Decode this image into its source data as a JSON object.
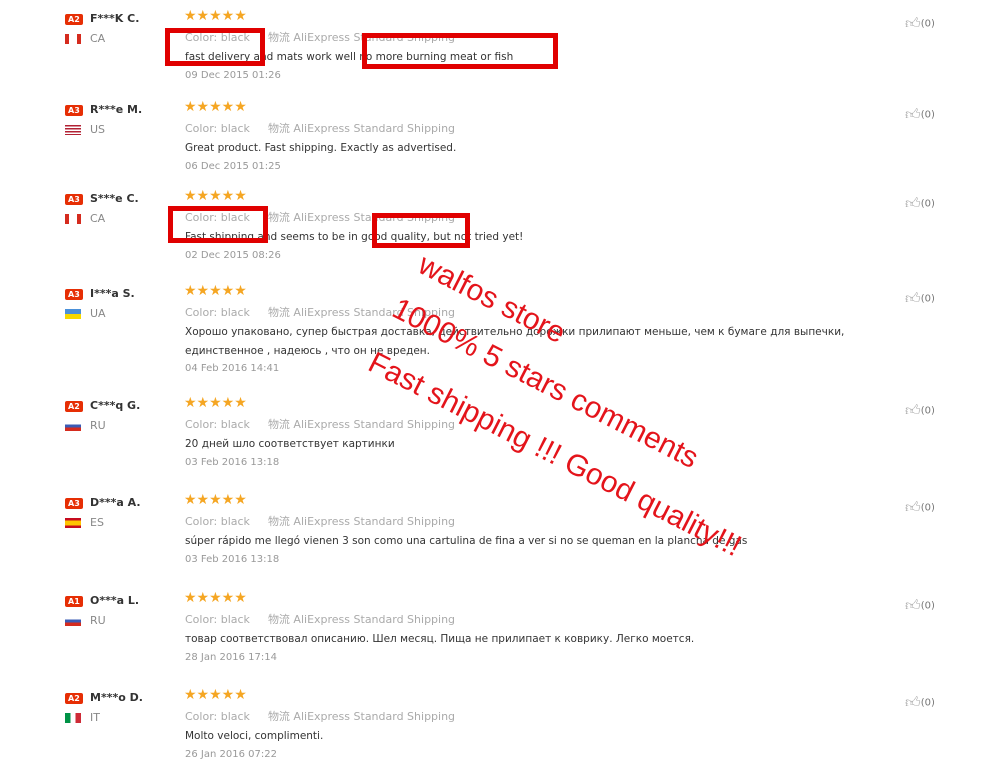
{
  "colors": {
    "badge": "#e62e04",
    "stars": "#f5a623",
    "highlight": "#e00000",
    "overlay": "#e4141b"
  },
  "icons": {
    "rating": "star-icon",
    "like": "thumbs-up-icon",
    "country": "flag-icon"
  },
  "reviews": [
    {
      "badge": "A2",
      "name": "F***K C.",
      "country": "CA",
      "stars": "★★★★★",
      "color_label": "Color:",
      "color": "black",
      "shipping": "物流 AliExpress Standard Shipping",
      "text": "fast delivery and mats work well no more burning meat or fish",
      "date": "09 Dec 2015 01:26",
      "likes": "(0)"
    },
    {
      "badge": "A3",
      "name": "R***e M.",
      "country": "US",
      "stars": "★★★★★",
      "color_label": "Color:",
      "color": "black",
      "shipping": "物流 AliExpress Standard Shipping",
      "text": "Great product. Fast shipping. Exactly as advertised.",
      "date": "06 Dec 2015 01:25",
      "likes": "(0)"
    },
    {
      "badge": "A3",
      "name": "S***e C.",
      "country": "CA",
      "stars": "★★★★★",
      "color_label": "Color:",
      "color": "black",
      "shipping": "物流 AliExpress Standard Shipping",
      "text": "Fast shipping and seems to be in good quality, but not tried yet!",
      "date": "02 Dec 2015 08:26",
      "likes": "(0)"
    },
    {
      "badge": "A3",
      "name": "I***a S.",
      "country": "UA",
      "stars": "★★★★★",
      "color_label": "Color:",
      "color": "black",
      "shipping": "物流 AliExpress Standard Shipping",
      "text": "Хорошо упаковано, супер быстрая доставка, действительно дорожки прилипают меньше, чем к бумаге для выпечки, единственное , надеюсь , что он не вреден.",
      "date": "04 Feb 2016 14:41",
      "likes": "(0)"
    },
    {
      "badge": "A2",
      "name": "C***q G.",
      "country": "RU",
      "stars": "★★★★★",
      "color_label": "Color:",
      "color": "black",
      "shipping": "物流 AliExpress Standard Shipping",
      "text": "20 дней шло соответствует картинки",
      "date": "03 Feb 2016 13:18",
      "likes": "(0)"
    },
    {
      "badge": "A3",
      "name": "D***a A.",
      "country": "ES",
      "stars": "★★★★★",
      "color_label": "Color:",
      "color": "black",
      "shipping": "物流 AliExpress Standard Shipping",
      "text": "súper rápido me llegó vienen 3 son como una cartulina de fina a ver si no se queman en la plancha de gas",
      "date": "03 Feb 2016 13:18",
      "likes": "(0)"
    },
    {
      "badge": "A1",
      "name": "O***a L.",
      "country": "RU",
      "stars": "★★★★★",
      "color_label": "Color:",
      "color": "black",
      "shipping": "物流 AliExpress Standard Shipping",
      "text": "товар соответствовал описанию. Шел месяц. Пища не прилипает к коврику. Легко моется.",
      "date": "28 Jan 2016 17:14",
      "likes": "(0)"
    },
    {
      "badge": "A2",
      "name": "M***o D.",
      "country": "IT",
      "stars": "★★★★★",
      "color_label": "Color:",
      "color": "black",
      "shipping": "物流 AliExpress Standard Shipping",
      "text": "Molto veloci, complimenti.",
      "date": "26 Jan 2016 07:22",
      "likes": "(0)"
    }
  ],
  "overlay": {
    "line1": "walfos store",
    "line2": "1000% 5 stars comments",
    "line3": "Fast shipping !!! Good quality!!!"
  }
}
